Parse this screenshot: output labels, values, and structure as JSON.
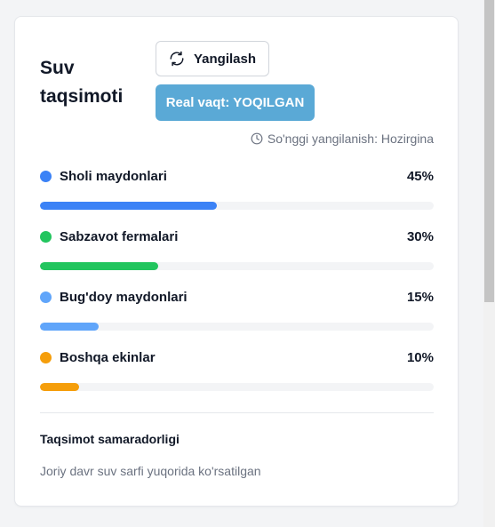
{
  "card": {
    "title": "Suv taqsimoti",
    "refresh_button": "Yangilash",
    "realtime_button": "Real vaqt: YOQILGAN",
    "last_updated": "So'nggi yangilanish: Hozirgina"
  },
  "distribution": [
    {
      "label": "Sholi maydonlari",
      "percent_text": "45%",
      "value": 45,
      "color": "#3b82f6"
    },
    {
      "label": "Sabzavot fermalari",
      "percent_text": "30%",
      "value": 30,
      "color": "#22c55e"
    },
    {
      "label": "Bug'doy maydonlari",
      "percent_text": "15%",
      "value": 15,
      "color": "#60a5fa"
    },
    {
      "label": "Boshqa ekinlar",
      "percent_text": "10%",
      "value": 10,
      "color": "#f59e0b"
    }
  ],
  "footer": {
    "title": "Taqsimot samaradorligi",
    "description": "Joriy davr suv sarfi yuqorida ko'rsatilgan"
  },
  "colors": {
    "accent_button": "#5aa9d6",
    "muted_text": "#6b7280"
  },
  "icons": {
    "refresh": "refresh-icon",
    "clock": "clock-icon"
  }
}
